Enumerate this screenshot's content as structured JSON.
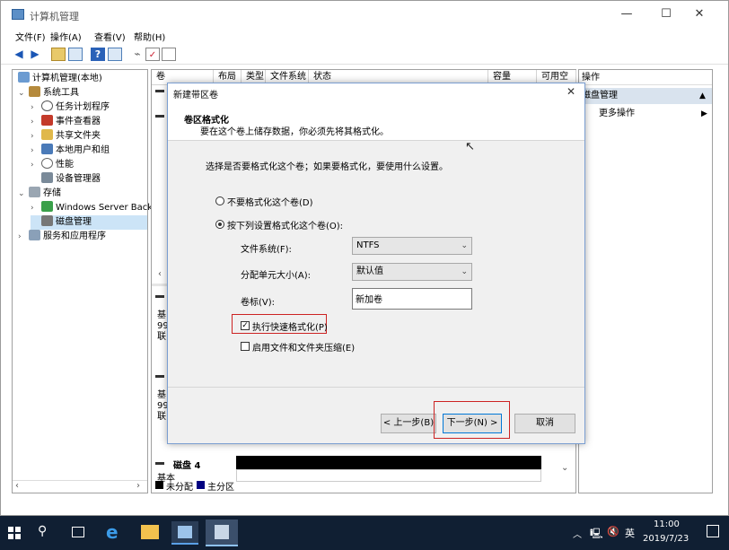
{
  "window": {
    "title": "计算机管理",
    "minimize": "—",
    "maximize": "☐",
    "close": "✕"
  },
  "menu": [
    "文件(F)",
    "操作(A)",
    "查看(V)",
    "帮助(H)"
  ],
  "tree": {
    "root": "计算机管理(本地)",
    "system_tools": "系统工具",
    "task_scheduler": "任务计划程序",
    "event_viewer": "事件查看器",
    "shared_folders": "共享文件夹",
    "local_users": "本地用户和组",
    "performance": "性能",
    "device_manager": "设备管理器",
    "storage": "存储",
    "windows_backup": "Windows Server Back",
    "disk_mgmt": "磁盘管理",
    "services": "服务和应用程序"
  },
  "columns": [
    "卷",
    "布局",
    "类型",
    "文件系统",
    "状态",
    "容量",
    "可用空"
  ],
  "disks": {
    "d1": [
      "基",
      "99",
      "联"
    ],
    "d2": [
      "基",
      "99",
      "联"
    ],
    "d4_name": "磁盘 4",
    "d4_type": "基本"
  },
  "legend": {
    "unallocated": "未分配",
    "primary": "主分区"
  },
  "actions": {
    "header": "操作",
    "section": "磁盘管理",
    "more": "更多操作"
  },
  "wizard": {
    "title": "新建带区卷",
    "heading": "卷区格式化",
    "subheading": "要在这个卷上储存数据，你必须先将其格式化。",
    "prompt": "选择是否要格式化这个卷；如果要格式化，要使用什么设置。",
    "opt_no_format": "不要格式化这个卷(D)",
    "opt_format": "按下列设置格式化这个卷(O):",
    "fs_label": "文件系统(F):",
    "fs_value": "NTFS",
    "alloc_label": "分配单元大小(A):",
    "alloc_value": "默认值",
    "vol_label": "卷标(V):",
    "vol_value": "新加卷",
    "quick_format": "执行快速格式化(P)",
    "compress": "启用文件和文件夹压缩(E)",
    "back": "< 上一步(B)",
    "next": "下一步(N) >",
    "cancel": "取消"
  },
  "taskbar": {
    "ime": "英",
    "time": "11:00",
    "date": "2019/7/23"
  },
  "colors": {
    "highlight": "#cc2222",
    "taskbar": "#101f33",
    "selection": "#cce4f7"
  }
}
